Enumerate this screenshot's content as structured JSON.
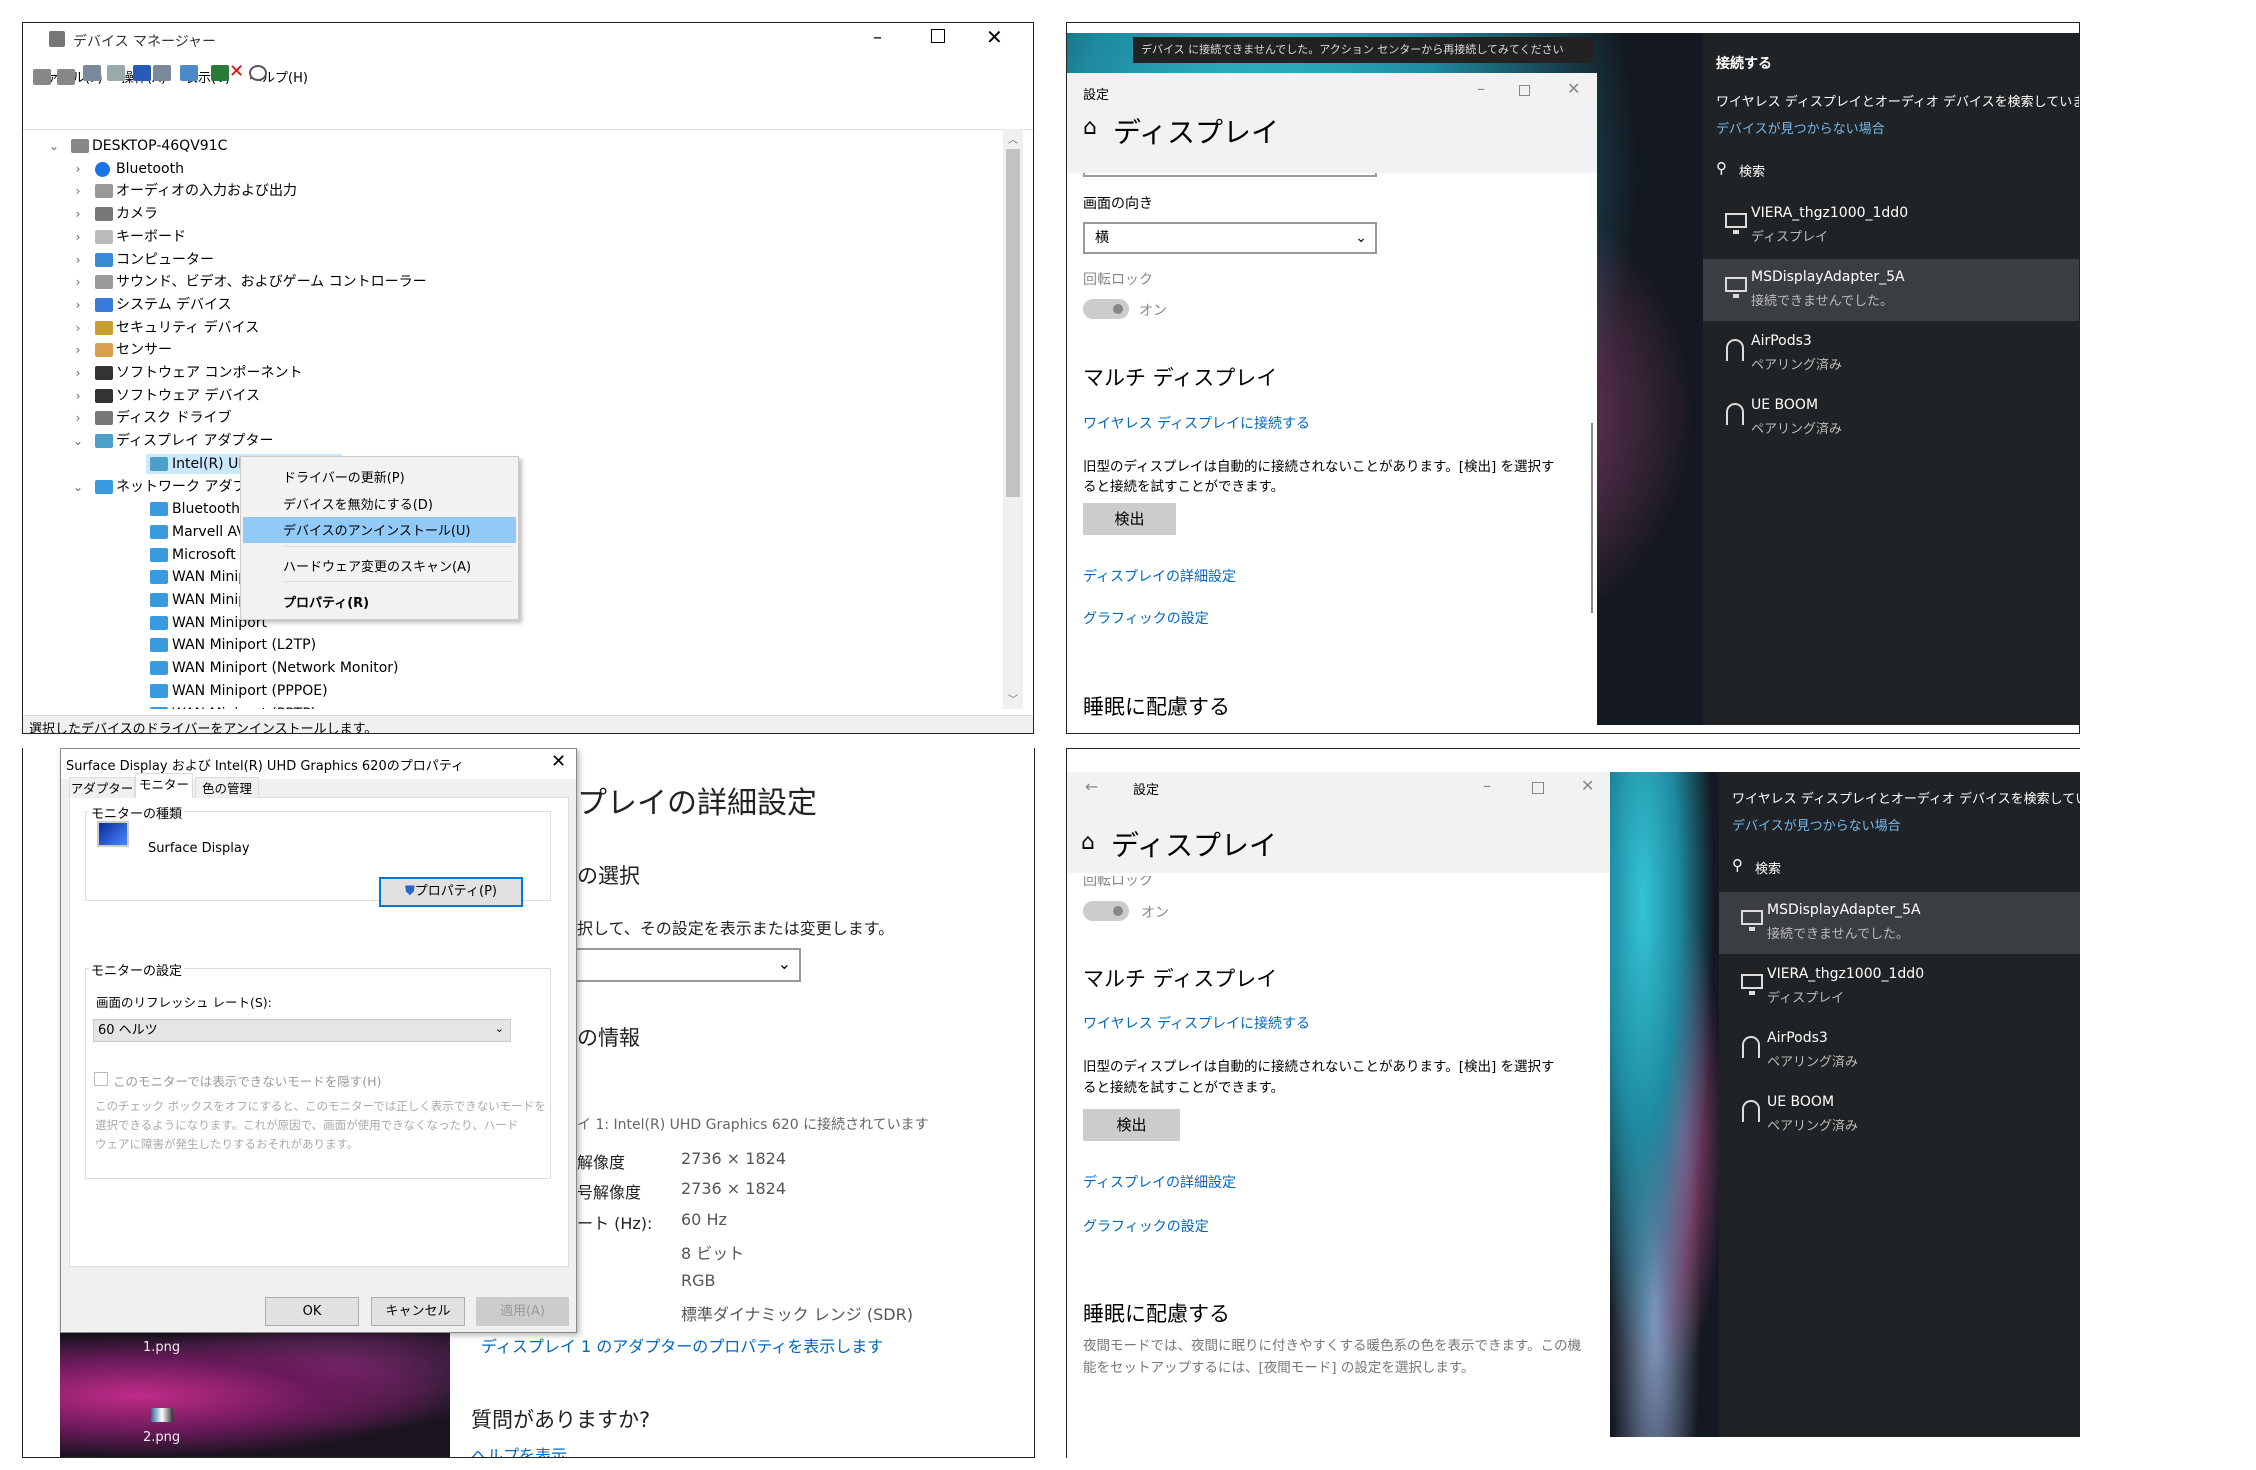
{
  "device_manager": {
    "title": "デバイス マネージャー",
    "menu": [
      "ファイル(F)",
      "操作(A)",
      "表示(V)",
      "ヘルプ(H)"
    ],
    "toolbar_icons": [
      "back-icon",
      "forward-icon",
      "show-hide-tree-icon",
      "properties-icon",
      "help-icon",
      "view-icon",
      "monitor-scan-icon",
      "update-driver-icon",
      "uninstall-icon",
      "disable-icon"
    ],
    "tree": [
      {
        "label": "DESKTOP-46QV91C",
        "level": 0,
        "state": "expanded",
        "icon": "computer"
      },
      {
        "label": "Bluetooth",
        "level": 1,
        "state": "collapsed",
        "icon": "bluetooth"
      },
      {
        "label": "オーディオの入力および出力",
        "level": 1,
        "state": "collapsed",
        "icon": "speaker"
      },
      {
        "label": "カメラ",
        "level": 1,
        "state": "collapsed",
        "icon": "camera"
      },
      {
        "label": "キーボード",
        "level": 1,
        "state": "collapsed",
        "icon": "keyboard"
      },
      {
        "label": "コンピューター",
        "level": 1,
        "state": "collapsed",
        "icon": "monitor"
      },
      {
        "label": "サウンド、ビデオ、およびゲーム コントローラー",
        "level": 1,
        "state": "collapsed",
        "icon": "speaker"
      },
      {
        "label": "システム デバイス",
        "level": 1,
        "state": "collapsed",
        "icon": "folder"
      },
      {
        "label": "セキュリティ デバイス",
        "level": 1,
        "state": "collapsed",
        "icon": "key"
      },
      {
        "label": "センサー",
        "level": 1,
        "state": "collapsed",
        "icon": "sensor"
      },
      {
        "label": "ソフトウェア コンポーネント",
        "level": 1,
        "state": "collapsed",
        "icon": "software"
      },
      {
        "label": "ソフトウェア デバイス",
        "level": 1,
        "state": "collapsed",
        "icon": "software"
      },
      {
        "label": "ディスク ドライブ",
        "level": 1,
        "state": "collapsed",
        "icon": "disk"
      },
      {
        "label": "ディスプレイ アダプター",
        "level": 1,
        "state": "expanded",
        "icon": "display"
      },
      {
        "label": "Intel(R) UHD G",
        "level": 2,
        "state": "selected",
        "icon": "display"
      },
      {
        "label": "ネットワーク アダプター",
        "level": 1,
        "state": "expanded",
        "icon": "network"
      },
      {
        "label": "Bluetooth Dev",
        "level": 2,
        "icon": "network"
      },
      {
        "label": "Marvell AVAST",
        "level": 2,
        "icon": "network"
      },
      {
        "label": "Microsoft Wi-F",
        "level": 2,
        "icon": "network"
      },
      {
        "label": "WAN Miniport",
        "level": 2,
        "icon": "network"
      },
      {
        "label": "WAN Miniport",
        "level": 2,
        "icon": "network"
      },
      {
        "label": "WAN Miniport",
        "level": 2,
        "icon": "network"
      },
      {
        "label": "WAN Miniport (L2TP)",
        "level": 2,
        "icon": "network"
      },
      {
        "label": "WAN Miniport (Network Monitor)",
        "level": 2,
        "icon": "network"
      },
      {
        "label": "WAN Miniport (PPPOE)",
        "level": 2,
        "icon": "network"
      },
      {
        "label": "WAN Miniport (PPTP)",
        "level": 2,
        "icon": "network"
      }
    ],
    "context_menu": [
      "ドライバーの更新(P)",
      "デバイスを無効にする(D)",
      "デバイスのアンインストール(U)",
      "ハードウェア変更のスキャン(A)",
      "プロパティ(R)"
    ],
    "context_menu_highlighted": 2,
    "status": "選択したデバイスのドライバーをアンインストールします。"
  },
  "settings_top": {
    "toast": "デバイス に接続できませんでした。アクション センターから再接続してみてください",
    "window_title": "設定",
    "header": "ディスプレイ",
    "orientation_label": "画面の向き",
    "orientation_value": "横",
    "rotation_lock_label": "回転ロック",
    "rotation_lock_state": "オン",
    "multi_display": "マルチ ディスプレイ",
    "wireless_link": "ワイヤレス ディスプレイに接続する",
    "detect_text_1": "旧型のディスプレイは自動的に接続されないことがあります。[検出] を選択す",
    "detect_text_2": "ると接続を試すことができます。",
    "detect_button": "検出",
    "advanced_link": "ディスプレイの詳細設定",
    "graphics_link": "グラフィックの設定",
    "sleep_heading": "睡眠に配慮する"
  },
  "connect_top": {
    "title": "接続する",
    "searching": "ワイヤレス ディスプレイとオーディオ デバイスを検索しています",
    "not_found_link": "デバイスが見つからない場合",
    "search": "検索",
    "devices": [
      {
        "name": "VIERA_thgz1000_1dd0",
        "status": "ディスプレイ",
        "icon": "monitor",
        "highlighted": false
      },
      {
        "name": "MSDisplayAdapter_5A",
        "status": "接続できませんでした。",
        "icon": "monitor",
        "highlighted": true
      },
      {
        "name": "AirPods3",
        "status": "ペアリング済み",
        "icon": "headphones",
        "highlighted": false
      },
      {
        "name": "UE BOOM",
        "status": "ペアリング済み",
        "icon": "headset",
        "highlighted": false
      }
    ]
  },
  "properties_dialog": {
    "title": "Surface Display および Intel(R) UHD Graphics 620のプロパティ",
    "tabs": [
      "アダプター",
      "モニター",
      "色の管理"
    ],
    "active_tab": 1,
    "monitor_type_group": "モニターの種類",
    "monitor_name": "Surface Display",
    "properties_button": "プロパティ(P)",
    "monitor_settings_group": "モニターの設定",
    "refresh_label": "画面のリフレッシュ レート(S):",
    "refresh_value": "60 ヘルツ",
    "hide_modes_label": "このモニターでは表示できないモードを隠す(H)",
    "hide_modes_checked": false,
    "desc": [
      "このチェック ボックスをオフにすると、このモニターでは正しく表示できないモードを",
      "選択できるようになります。これが原因で、画面が使用できなくなったり、ハード",
      "ウェアに障害が発生したりするおそれがあります。"
    ],
    "ok": "OK",
    "cancel": "キャンセル",
    "apply": "適用(A)"
  },
  "desktop_icons": [
    "1.png",
    "2.png"
  ],
  "advanced_page": {
    "heading": "プレイの詳細設定",
    "select_heading": "の選択",
    "select_desc": "択して、その設定を表示または変更します。",
    "info_heading": "の情報",
    "connected": "イ 1: Intel(R) UHD Graphics 620 に接続されています",
    "rows": [
      {
        "label": "解像度",
        "value": "2736 × 1824"
      },
      {
        "label": "号解像度",
        "value": "2736 × 1824"
      },
      {
        "label": "ート (Hz):",
        "value": "60 Hz"
      },
      {
        "label": "",
        "value": "8 ビット"
      },
      {
        "label": "",
        "value": "RGB"
      },
      {
        "label": "",
        "value": "標準ダイナミック レンジ (SDR)"
      }
    ],
    "adapter_link": "ディスプレイ 1 のアダプターのプロパティを表示します",
    "question": "質問がありますか?",
    "help_link": "ヘルプを表示"
  },
  "settings_bottom": {
    "window_title": "設定",
    "header": "ディスプレイ",
    "rotation_lock_label": "回転ロック",
    "rotation_lock_state": "オン",
    "multi_display": "マルチ ディスプレイ",
    "wireless_link": "ワイヤレス ディスプレイに接続する",
    "detect_text_1": "旧型のディスプレイは自動的に接続されないことがあります。[検出] を選択す",
    "detect_text_2": "ると接続を試すことができます。",
    "detect_button": "検出",
    "advanced_link": "ディスプレイの詳細設定",
    "graphics_link": "グラフィックの設定",
    "sleep_heading": "睡眠に配慮する",
    "sleep_desc_1": "夜間モードでは、夜間に眠りに付きやすくする暖色系の色を表示できます。この機",
    "sleep_desc_2": "能をセットアップするには、[夜間モード] の設定を選択します。"
  },
  "connect_bottom": {
    "searching": "ワイヤレス ディスプレイとオーディオ デバイスを検索しています",
    "not_found_link": "デバイスが見つからない場合",
    "search": "検索",
    "devices": [
      {
        "name": "MSDisplayAdapter_5A",
        "status": "接続できませんでした。",
        "icon": "monitor",
        "highlighted": true
      },
      {
        "name": "VIERA_thgz1000_1dd0",
        "status": "ディスプレイ",
        "icon": "monitor",
        "highlighted": false
      },
      {
        "name": "AirPods3",
        "status": "ペアリング済み",
        "icon": "headphones",
        "highlighted": false
      },
      {
        "name": "UE BOOM",
        "status": "ペアリング済み",
        "icon": "headset",
        "highlighted": false
      }
    ]
  },
  "colors": {
    "accent": "#0067c0",
    "menu_highlight": "#91c9f7",
    "selection": "#cce8ff",
    "dark_panel": "#1f2326",
    "dark_highlight": "#3a3e42"
  }
}
